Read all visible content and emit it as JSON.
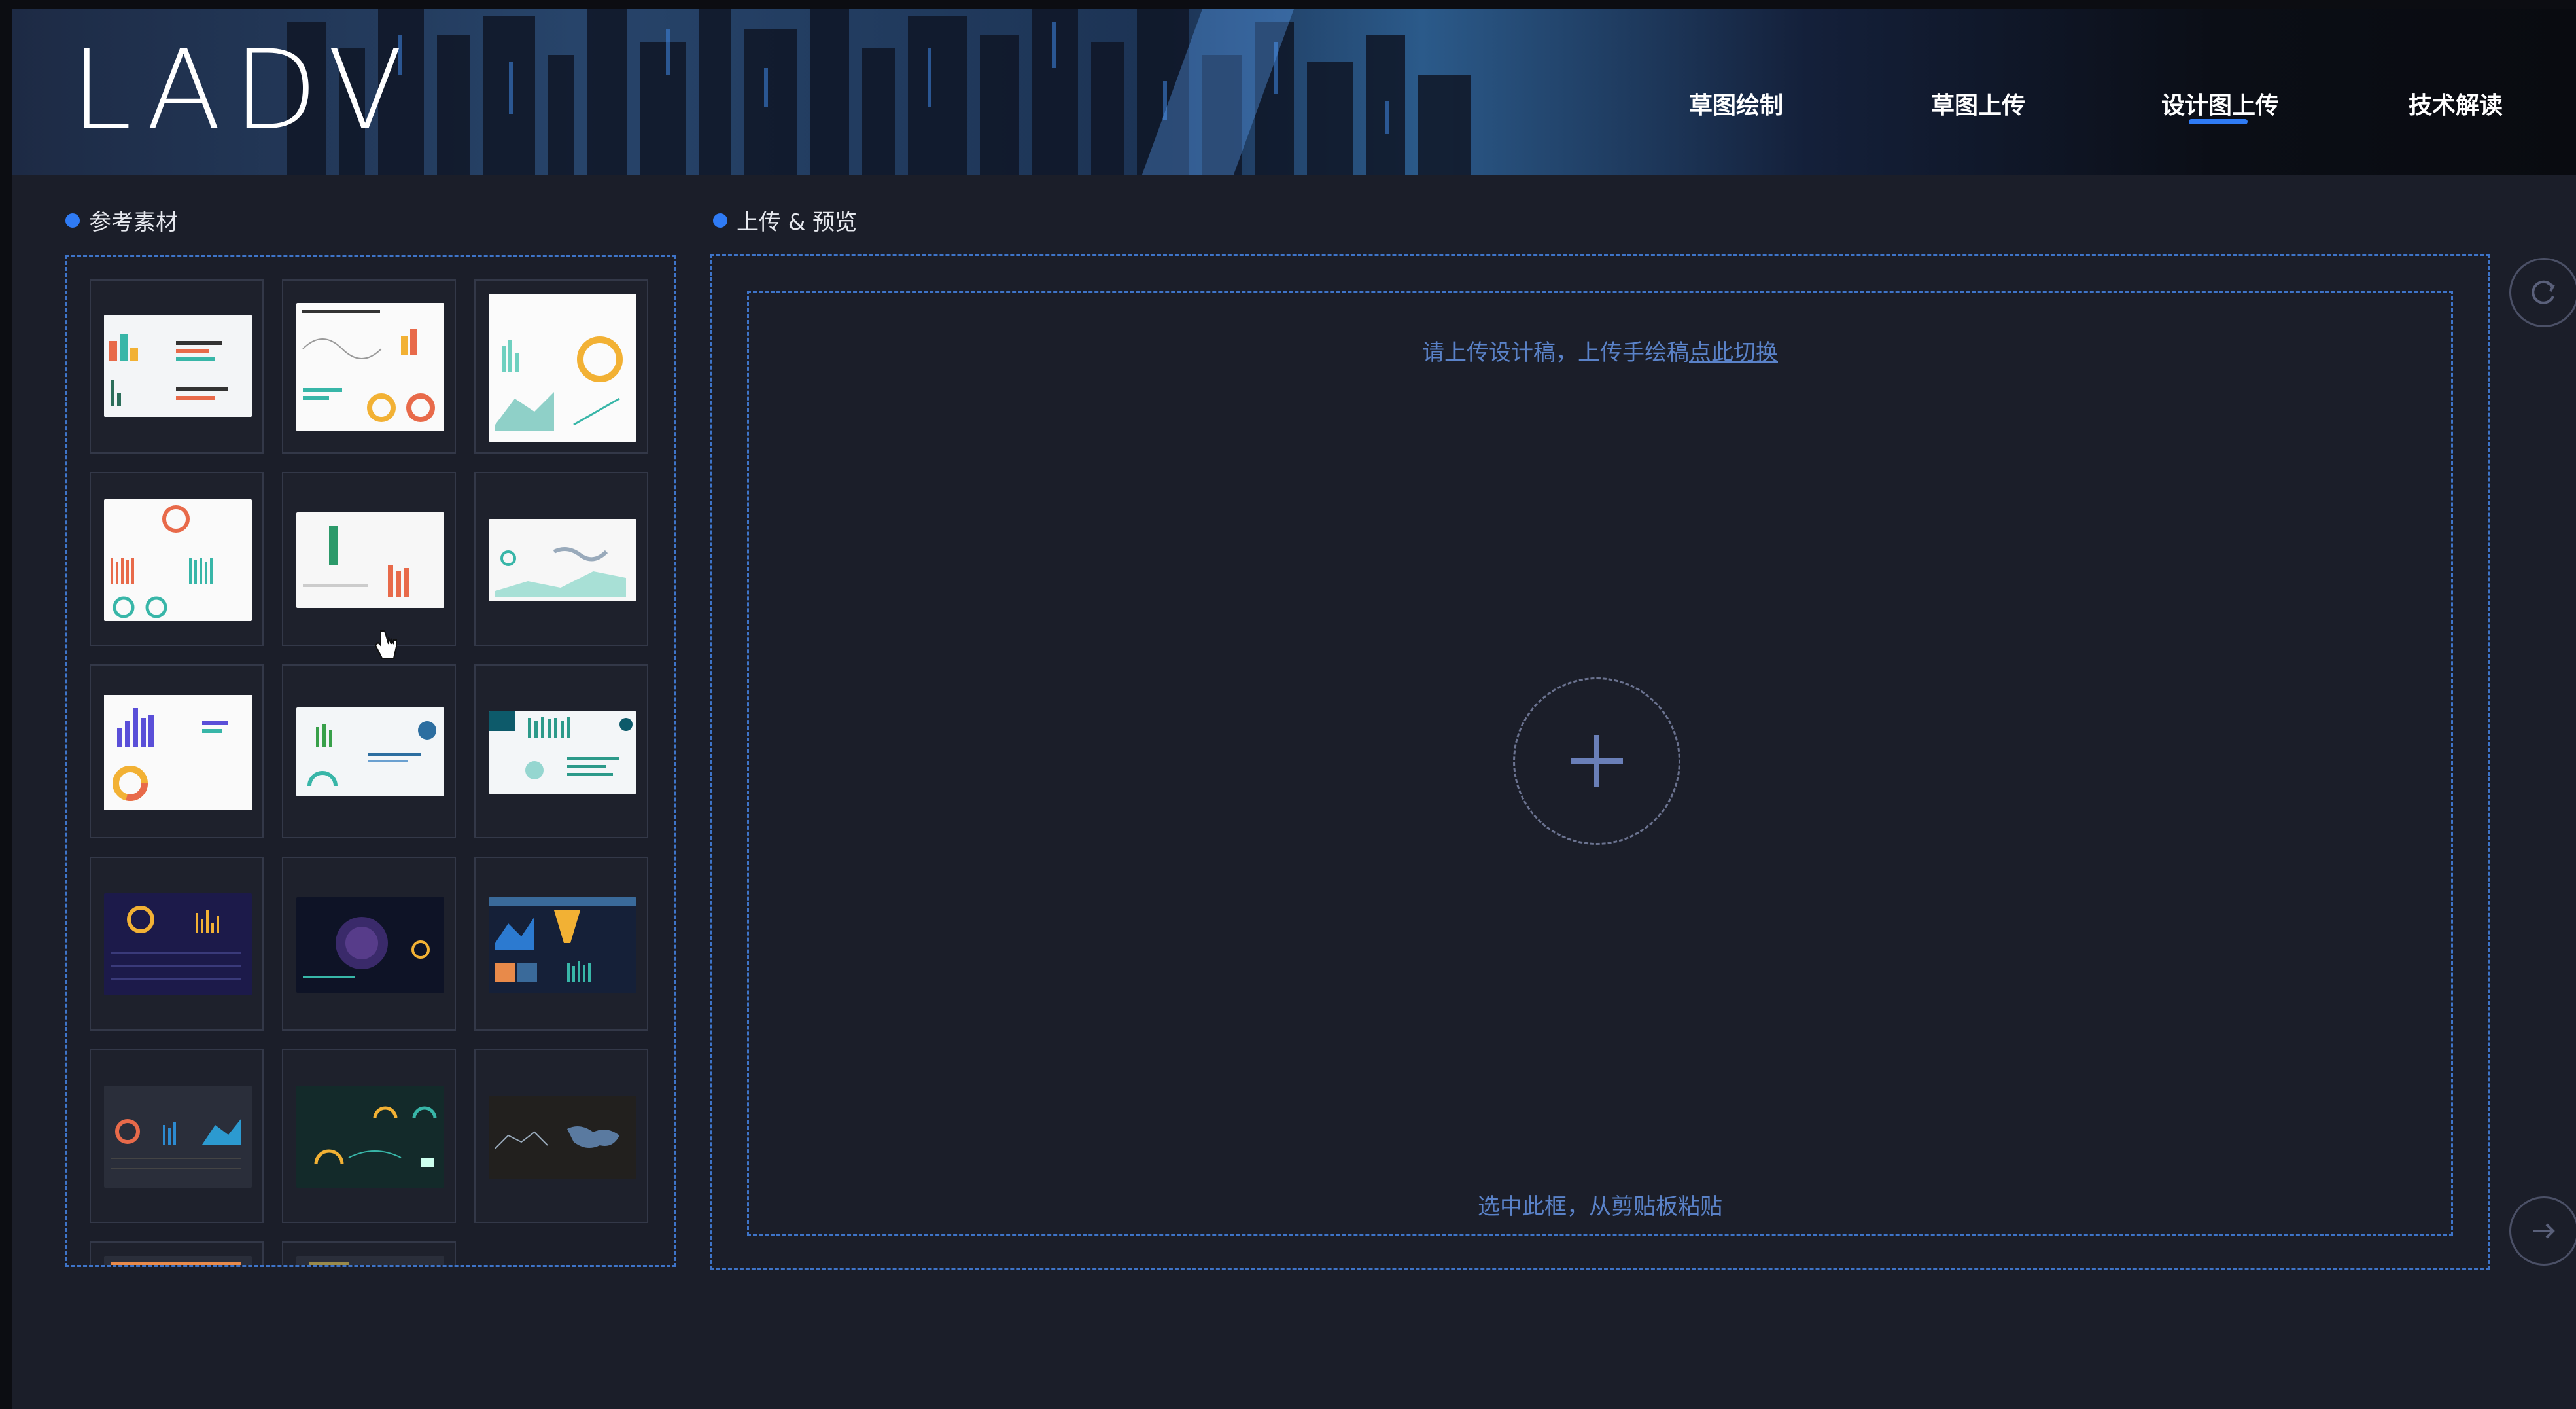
{
  "app": {
    "logo": "LADV"
  },
  "nav": {
    "items": [
      {
        "label": "草图绘制"
      },
      {
        "label": "草图上传"
      },
      {
        "label": "设计图上传",
        "active": true
      },
      {
        "label": "技术解读"
      }
    ]
  },
  "reference": {
    "title": "参考素材"
  },
  "upload": {
    "title": "上传 & 预览",
    "hint_prefix": "请上传设计稿，上传手绘稿",
    "hint_link": "点此切换",
    "paste_hint": "选中此框，从剪贴板粘贴"
  },
  "colors": {
    "accent": "#2f7bf5",
    "background": "#1b1e29",
    "dashed_border": "#3e74c8"
  },
  "icons": {
    "plus": "plus-icon",
    "refresh": "refresh-icon",
    "next": "arrow-right-icon"
  }
}
